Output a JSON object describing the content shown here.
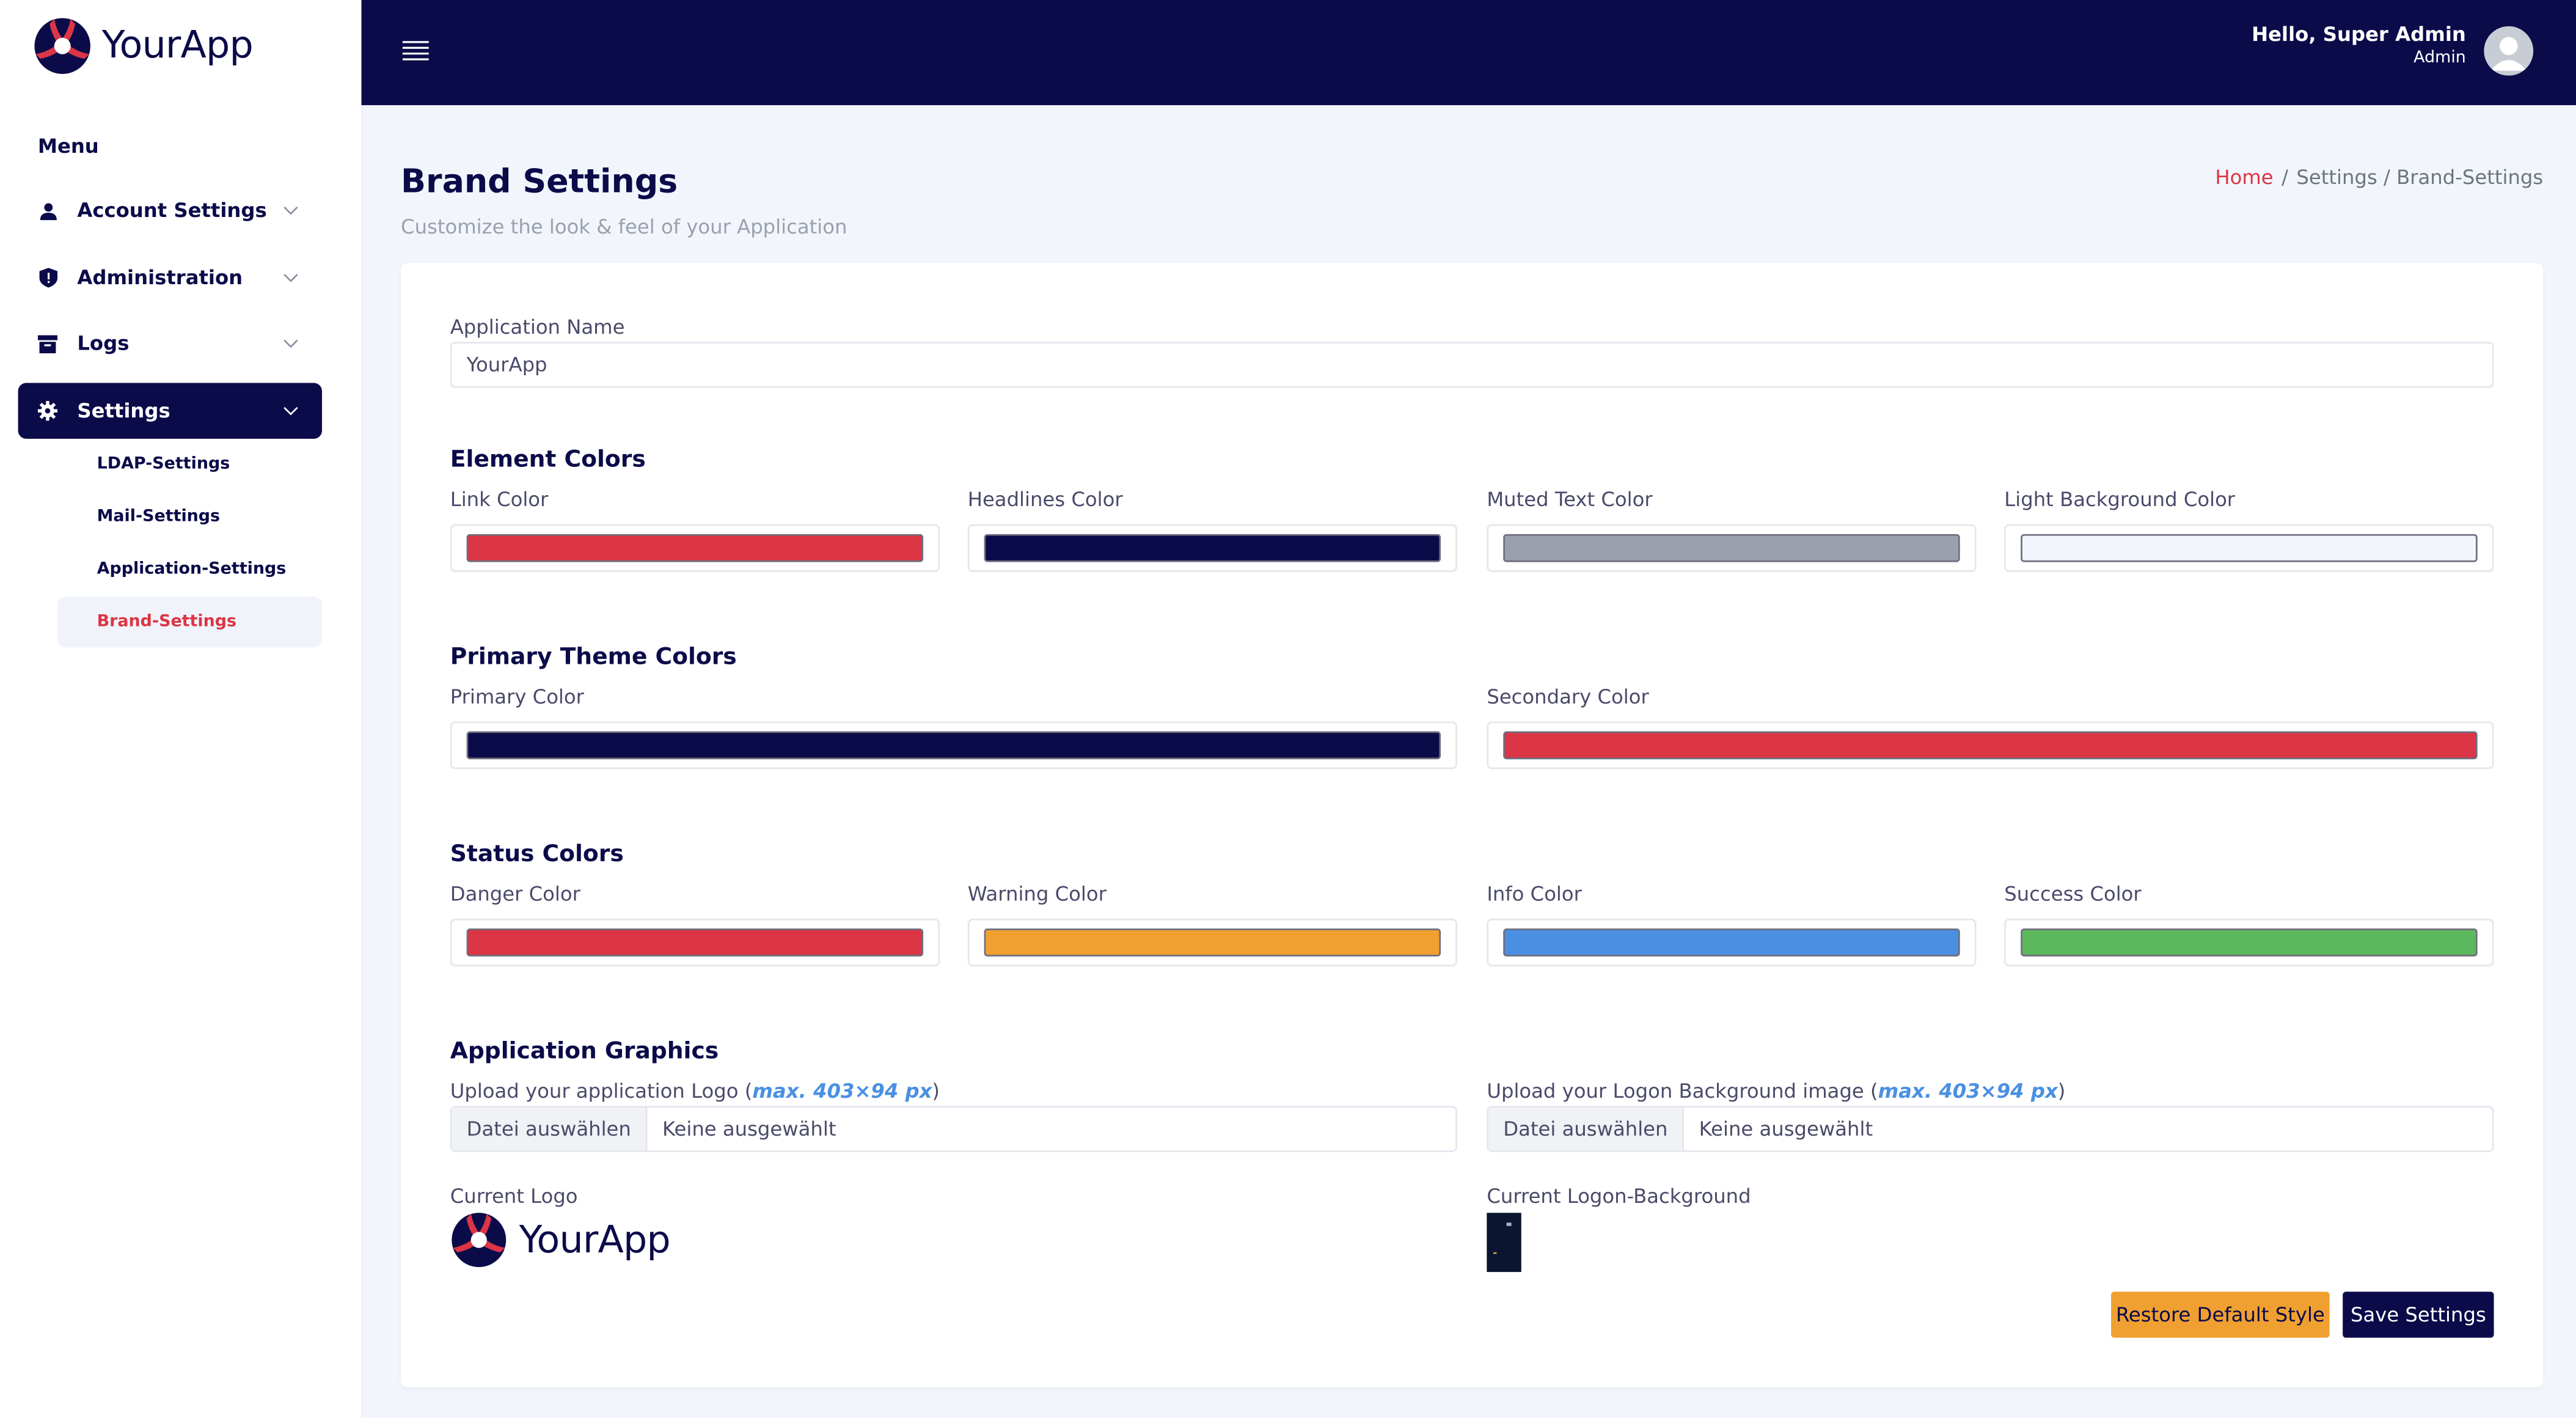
{
  "app": {
    "name": "YourApp"
  },
  "sidebar": {
    "menu_title": "Menu",
    "items": [
      {
        "label": "Account Settings",
        "icon": "user-icon"
      },
      {
        "label": "Administration",
        "icon": "shield-icon"
      },
      {
        "label": "Logs",
        "icon": "archive-icon"
      },
      {
        "label": "Settings",
        "icon": "gear-icon",
        "active": true
      }
    ],
    "sub_items": [
      {
        "label": "LDAP-Settings"
      },
      {
        "label": "Mail-Settings"
      },
      {
        "label": "Application-Settings"
      },
      {
        "label": "Brand-Settings",
        "active": true
      }
    ]
  },
  "topbar": {
    "greeting": "Hello, Super Admin",
    "role": "Admin"
  },
  "header": {
    "title": "Brand Settings",
    "subtitle": "Customize the look & feel of your Application",
    "breadcrumb": {
      "home": "Home",
      "separator": "/",
      "path": "Settings / Brand-Settings"
    }
  },
  "form": {
    "app_name": {
      "label": "Application Name",
      "value": "YourApp"
    },
    "element_colors": {
      "title": "Element Colors",
      "fields": [
        {
          "label": "Link Color",
          "color": "#dc3545"
        },
        {
          "label": "Headlines Color",
          "color": "#0b0b4a"
        },
        {
          "label": "Muted Text Color",
          "color": "#9aa0ac"
        },
        {
          "label": "Light Background Color",
          "color": "#f2f6fc"
        }
      ]
    },
    "primary_theme": {
      "title": "Primary Theme Colors",
      "fields": [
        {
          "label": "Primary Color",
          "color": "#0b0b4a"
        },
        {
          "label": "Secondary Color",
          "color": "#dc3545"
        }
      ]
    },
    "status_colors": {
      "title": "Status Colors",
      "fields": [
        {
          "label": "Danger Color",
          "color": "#dc3545"
        },
        {
          "label": "Warning Color",
          "color": "#f0a030"
        },
        {
          "label": "Info Color",
          "color": "#4a90e2"
        },
        {
          "label": "Success Color",
          "color": "#5cb85c"
        }
      ]
    },
    "graphics": {
      "title": "Application Graphics",
      "logo_upload": {
        "label_prefix": "Upload your application Logo (",
        "hint": "max. 403×94 px",
        "label_suffix": ")",
        "button": "Datei auswählen",
        "status": "Keine ausgewählt"
      },
      "bg_upload": {
        "label_prefix": "Upload your Logon Background image (",
        "hint": "max. 403×94 px",
        "label_suffix": ")",
        "button": "Datei auswählen",
        "status": "Keine ausgewählt"
      },
      "current_logo_label": "Current Logo",
      "current_logo_text": "YourApp",
      "current_bg_label": "Current Logon-Background"
    },
    "buttons": {
      "restore": "Restore Default Style",
      "save": "Save Settings"
    }
  }
}
